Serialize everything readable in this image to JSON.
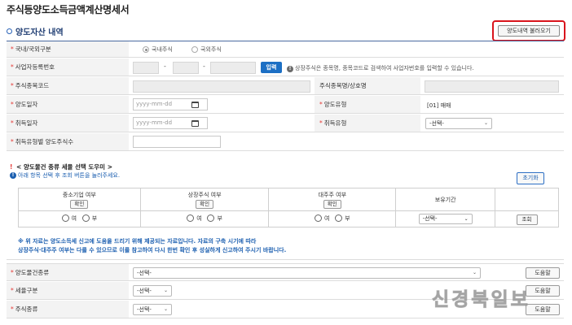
{
  "page_title": "주식등양도소득금액계산명세서",
  "section_title": "양도자산 내역",
  "load_button": "양도내역 불러오기",
  "rows": {
    "domestic_foreign": {
      "label": "국내/국외구분",
      "options": [
        "국내주식",
        "국외주식"
      ],
      "selected": "국내주식"
    },
    "biz_reg_no": {
      "label": "사업자등록번호",
      "input_button": "입력",
      "hint": "상장주식은 종목명, 종목코드로 검색하여 사업자번호를 입력할 수 있습니다."
    },
    "stock_code": {
      "label": "주식종목코드",
      "name_label": "주식종목명/상호명"
    },
    "transfer_date": {
      "label": "양도일자",
      "placeholder": "yyyy-mm-dd",
      "type_label": "양도유형",
      "type_value": "[01] 매매"
    },
    "acquire_date": {
      "label": "취득일자",
      "placeholder": "yyyy-mm-dd",
      "type_label": "취득유형",
      "type_value": "-선택-"
    },
    "qty": {
      "label": "취득유형별 양도주식수"
    }
  },
  "helper": {
    "title": "< 양도물건 종류 세율 선택 도우미 >",
    "note": "아래 항목 선택 후 조회 버튼을 눌러주세요.",
    "reset_button": "초기화",
    "columns": [
      "중소기업 여부",
      "상장주식 여부",
      "대주주 여부",
      "보유기간"
    ],
    "confirm_button": "확인",
    "yes": "여",
    "no": "부",
    "period_value": "-선택-",
    "search_button": "조회"
  },
  "notice_lines": [
    "※ 위 자료는 양도소득세 신고에 도움을 드리기 위해 제공되는 자료입니다. 자료의 구축 시기에 따라",
    "상장주식·대주주 여부는 다를 수 있으므로 이를 참고하여 다시 한번 확인 후 성실하게 신고하여 주시기 바랍니다."
  ],
  "bottom_rows": {
    "item_type": {
      "label": "양도물건종류",
      "value": "-선택-",
      "help": "도움말"
    },
    "tax_rate": {
      "label": "세율구분",
      "value": "-선택-",
      "help": "도움말"
    },
    "stock_type": {
      "label": "주식종류",
      "value": "-선택-",
      "help": "도움말"
    }
  },
  "watermark": "신경북일보"
}
